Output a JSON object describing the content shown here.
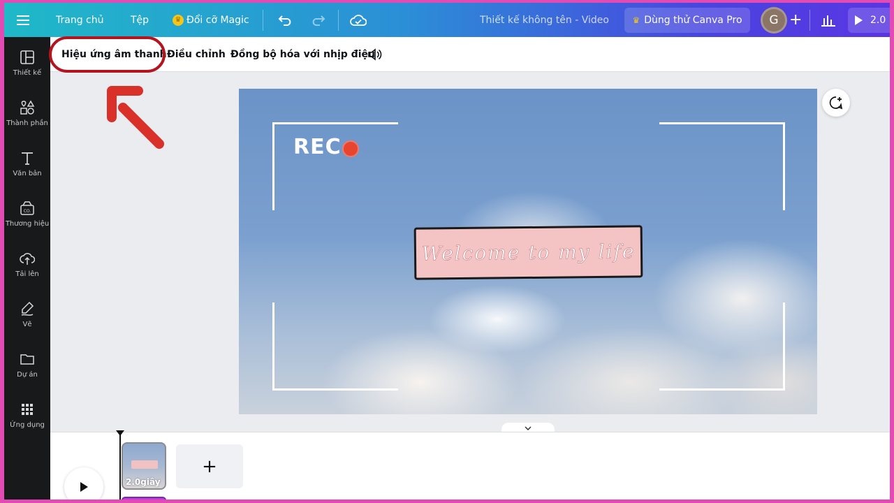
{
  "topbar": {
    "menu_icon": "hamburger-icon",
    "home": "Trang chủ",
    "file": "Tệp",
    "magic_resize": "Đổi cỡ Magic",
    "doc_title": "Thiết kế không tên - Video",
    "pro_button": "Dùng thử Canva Pro",
    "avatar_initial": "G",
    "share_label": "2.0"
  },
  "sidebar": {
    "items": [
      {
        "label": "Thiết kế",
        "icon": "layout-icon"
      },
      {
        "label": "Thành phần",
        "icon": "shapes-icon"
      },
      {
        "label": "Văn bản",
        "icon": "text-icon"
      },
      {
        "label": "Thương hiệu",
        "icon": "brand-icon"
      },
      {
        "label": "Tải lên",
        "icon": "upload-cloud-icon"
      },
      {
        "label": "Vẽ",
        "icon": "draw-icon"
      },
      {
        "label": "Dự án",
        "icon": "folder-icon"
      },
      {
        "label": "Ứng dụng",
        "icon": "apps-grid-icon"
      }
    ]
  },
  "context_toolbar": {
    "sound_effects": "Hiệu ứng âm thanh",
    "adjust": "Điều chỉnh",
    "beat_sync": "Đồng bộ hóa với nhịp điệu"
  },
  "canvas": {
    "rec_label": "REC",
    "welcome_text": "Welcome to my life"
  },
  "timeline": {
    "clip_duration": "2.0giây",
    "add_label": "+"
  },
  "colors": {
    "highlight_circle": "#b3141e",
    "arrow": "#d9302a",
    "rec_dot": "#e8452e",
    "welcome_bg": "#f4c4c4"
  }
}
